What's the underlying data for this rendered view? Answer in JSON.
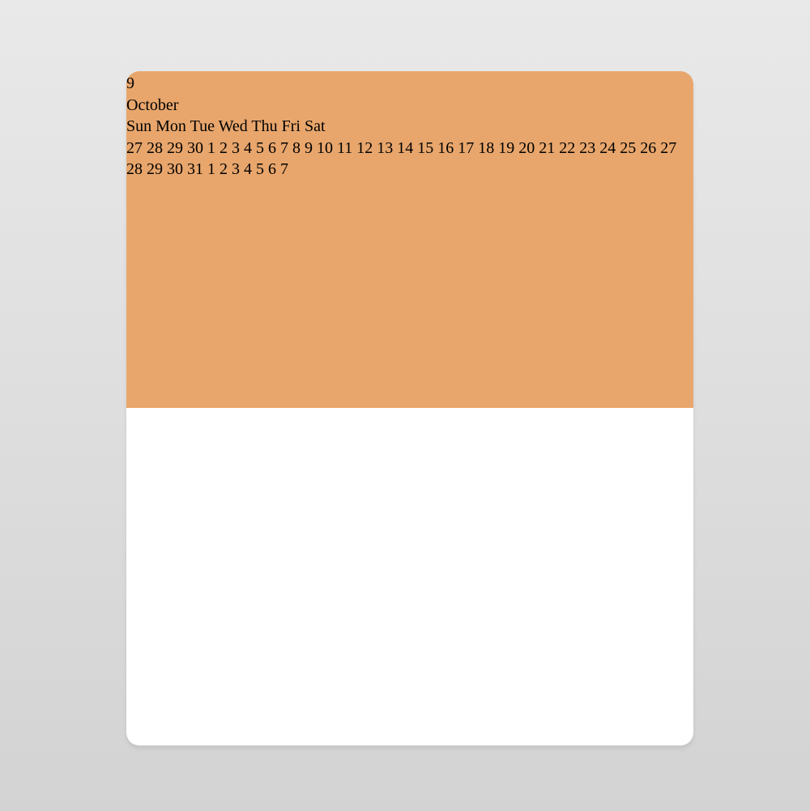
{
  "calendar": {
    "day_number": "9",
    "month": "October",
    "weekdays": [
      "Sun",
      "Mon",
      "Tue",
      "Wed",
      "Thu",
      "Fri",
      "Sat"
    ],
    "days": [
      "27",
      "28",
      "29",
      "30",
      "1",
      "2",
      "3",
      "4",
      "5",
      "6",
      "7",
      "8",
      "9",
      "10",
      "11",
      "12",
      "13",
      "14",
      "15",
      "16",
      "17",
      "18",
      "19",
      "20",
      "21",
      "22",
      "23",
      "24",
      "25",
      "26",
      "27",
      "28",
      "29",
      "30",
      "31",
      "1",
      "2",
      "3",
      "4",
      "5",
      "6",
      "7"
    ]
  },
  "colors": {
    "header_bg": "#e8a66c",
    "card_bg": "#ffffff",
    "page_bg_top": "#e9e9e9",
    "page_bg_bottom": "#d3d3d3"
  }
}
